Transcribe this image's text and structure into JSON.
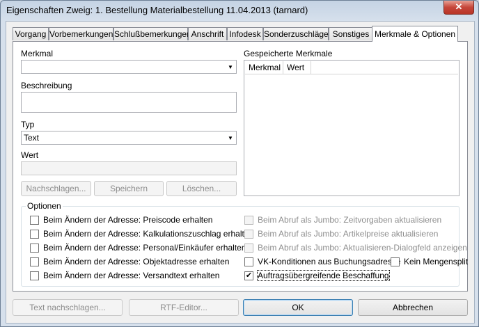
{
  "window": {
    "title": "Eigenschaften Zweig: 1. Bestellung Materialbestellung 11.04.2013 (tarnard)",
    "close_glyph": "✕"
  },
  "tabs": [
    {
      "label": "Vorgang"
    },
    {
      "label": "Vorbemerkungen"
    },
    {
      "label": "Schlußbemerkungen"
    },
    {
      "label": "Anschrift"
    },
    {
      "label": "Infodesk"
    },
    {
      "label": "Sonderzuschläge"
    },
    {
      "label": "Sonstiges"
    },
    {
      "label": "Merkmale & Optionen"
    }
  ],
  "form": {
    "merkmal_label": "Merkmal",
    "merkmal_value": "",
    "beschreibung_label": "Beschreibung",
    "beschreibung_value": "",
    "typ_label": "Typ",
    "typ_value": "Text",
    "wert_label": "Wert",
    "wert_value": "",
    "nachschlagen_button": "Nachschlagen...",
    "speichern_button": "Speichern",
    "loeschen_button": "Löschen..."
  },
  "saved": {
    "label": "Gespeicherte Merkmale",
    "columns": [
      "Merkmal",
      "Wert"
    ]
  },
  "options": {
    "title": "Optionen",
    "left": [
      {
        "label": "Beim Ändern der Adresse: Preiscode erhalten",
        "checked": false
      },
      {
        "label": "Beim Ändern der Adresse: Kalkulationszuschlag erhalten",
        "checked": false
      },
      {
        "label": "Beim Ändern der Adresse: Personal/Einkäufer erhalten",
        "checked": false
      },
      {
        "label": "Beim Ändern der Adresse: Objektadresse erhalten",
        "checked": false
      },
      {
        "label": "Beim Ändern der Adresse: Versandtext erhalten",
        "checked": false
      }
    ],
    "right": [
      {
        "label": "Beim Abruf als Jumbo: Zeitvorgaben aktualisieren",
        "checked": false,
        "disabled": true
      },
      {
        "label": "Beim Abruf als Jumbo: Artikelpreise aktualisieren",
        "checked": false,
        "disabled": true
      },
      {
        "label": "Beim Abruf als Jumbo: Aktualisieren-Dialogfeld anzeigen",
        "checked": false,
        "disabled": true
      },
      {
        "label": "VK-Konditionen aus Buchungsadresse",
        "checked": false,
        "disabled": false
      },
      {
        "label": "Auftragsübergreifende Beschaffung",
        "checked": true,
        "disabled": false
      }
    ],
    "kein_mengensplit": {
      "label": "Kein Mengensplit",
      "checked": false
    },
    "check_glyph": "✔"
  },
  "footer": {
    "text_nachschlagen": "Text nachschlagen...",
    "rtf_editor": "RTF-Editor...",
    "ok": "OK",
    "abbrechen": "Abbrechen"
  }
}
